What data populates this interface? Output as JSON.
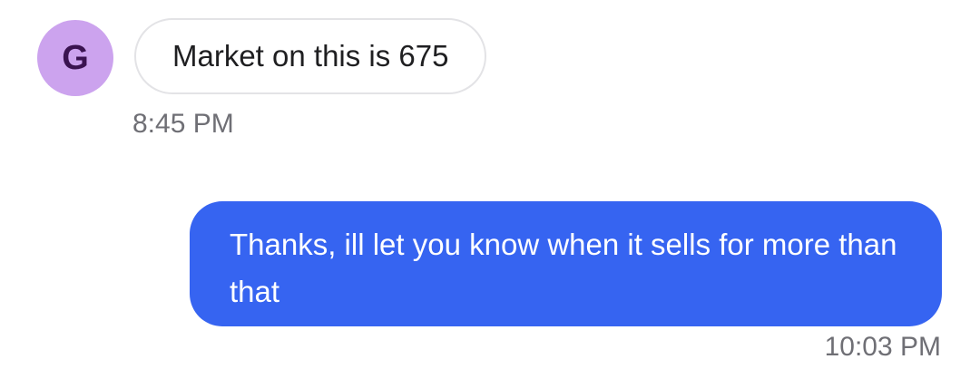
{
  "messages": {
    "incoming": {
      "avatar_initial": "G",
      "text": "Market on this is 675",
      "time": "8:45 PM"
    },
    "outgoing": {
      "text": "Thanks, ill let you know when it sells for more than that",
      "time": "10:03 PM"
    }
  },
  "colors": {
    "avatar_bg": "#cca3ee",
    "avatar_text": "#3a1350",
    "outgoing_bubble": "#3664f1",
    "incoming_border": "#e3e3e6",
    "timestamp": "#6f6f75"
  }
}
